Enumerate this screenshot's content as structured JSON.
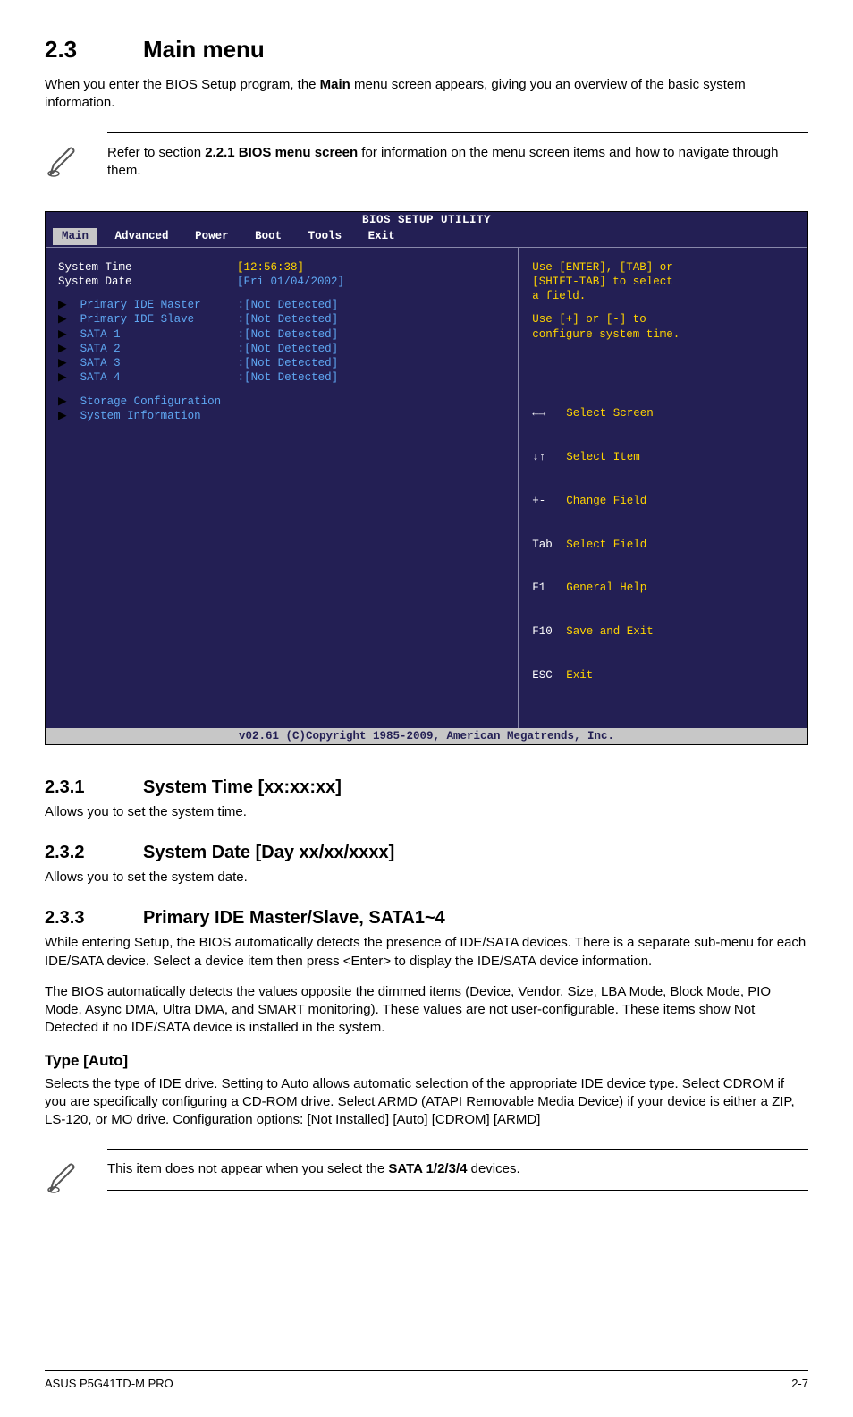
{
  "section": {
    "num": "2.3",
    "title": "Main menu"
  },
  "intro": {
    "a": "When you enter the BIOS Setup program, the ",
    "b": "Main",
    "c": " menu screen appears, giving you an overview of the basic system information."
  },
  "note1": {
    "a": "Refer to section ",
    "b": "2.2.1 BIOS menu screen",
    "c": " for information on the menu screen items and how to navigate through them."
  },
  "bios": {
    "title": "BIOS SETUP UTILITY",
    "tabs": {
      "t0": "Main",
      "t1": "Advanced",
      "t2": "Power",
      "t3": "Boot",
      "t4": "Tools",
      "t5": "Exit"
    },
    "rows": {
      "r0": {
        "label": "System Time",
        "val": "[12:56:38]"
      },
      "r1": {
        "label": "System Date",
        "val": "[Fri 01/04/2002]"
      },
      "r2": {
        "label": "Primary IDE Master",
        "val": ":[Not Detected]"
      },
      "r3": {
        "label": "Primary IDE Slave",
        "val": ":[Not Detected]"
      },
      "r4": {
        "label": "SATA 1",
        "val": ":[Not Detected]"
      },
      "r5": {
        "label": "SATA 2",
        "val": ":[Not Detected]"
      },
      "r6": {
        "label": "SATA 3",
        "val": ":[Not Detected]"
      },
      "r7": {
        "label": "SATA 4",
        "val": ":[Not Detected]"
      },
      "r8": {
        "label": "Storage Configuration"
      },
      "r9": {
        "label": "System Information"
      }
    },
    "help": {
      "l1": "Use [ENTER], [TAB] or",
      "l2": "[SHIFT-TAB] to select",
      "l3": "a field.",
      "l4": "Use [+] or [-] to",
      "l5": "configure system time."
    },
    "keys": {
      "k0": {
        "k": "←→",
        "d": "Select Screen"
      },
      "k1": {
        "k": "↓↑",
        "d": "Select Item"
      },
      "k2": {
        "k": "+-",
        "d": "Change Field"
      },
      "k3": {
        "k": "Tab",
        "d": "Select Field"
      },
      "k4": {
        "k": "F1",
        "d": "General Help"
      },
      "k5": {
        "k": "F10",
        "d": "Save and Exit"
      },
      "k6": {
        "k": "ESC",
        "d": "Exit"
      }
    },
    "footer": "v02.61 (C)Copyright 1985-2009, American Megatrends, Inc."
  },
  "s231": {
    "num": "2.3.1",
    "title": "System Time [xx:xx:xx]",
    "body": "Allows you to set the system time."
  },
  "s232": {
    "num": "2.3.2",
    "title": "System Date [Day xx/xx/xxxx]",
    "body": "Allows you to set the system date."
  },
  "s233": {
    "num": "2.3.3",
    "title": "Primary IDE Master/Slave, SATA1~4",
    "p1": "While entering Setup, the BIOS automatically detects the presence of IDE/SATA devices. There is a separate sub-menu for each IDE/SATA device. Select a device item then press <Enter> to display the IDE/SATA device information.",
    "p2": "The BIOS automatically detects the values opposite the dimmed items (Device, Vendor, Size, LBA Mode, Block Mode, PIO Mode, Async DMA, Ultra DMA, and SMART monitoring). These values are not user-configurable. These items show Not Detected if no IDE/SATA device is installed in the system."
  },
  "type": {
    "h": "Type [Auto]",
    "body": "Selects the type of IDE drive. Setting to Auto allows automatic selection of the appropriate IDE device type. Select CDROM if you are specifically configuring a CD-ROM drive. Select ARMD (ATAPI Removable Media Device) if your device is either a ZIP, LS-120, or MO drive. Configuration options: [Not Installed] [Auto] [CDROM] [ARMD]"
  },
  "note2": {
    "a": "This item does not appear when you select the ",
    "b": "SATA 1/2/3/4",
    "c": " devices."
  },
  "footer": {
    "left": "ASUS P5G41TD-M PRO",
    "right": "2-7"
  }
}
